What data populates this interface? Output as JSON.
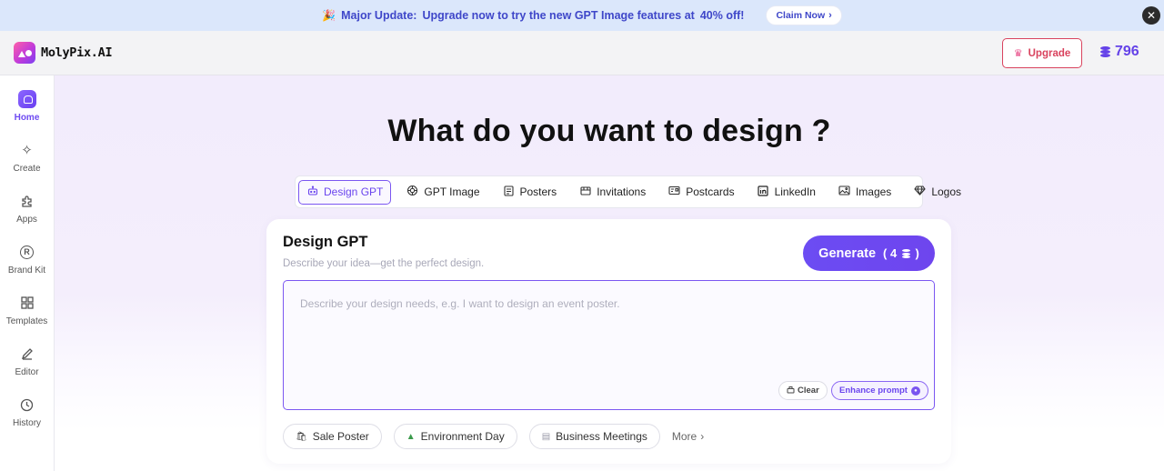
{
  "banner": {
    "party_icon": "party-popper-icon",
    "major": "Major Update:",
    "message": "Upgrade now to try the new GPT Image features at",
    "discount": "40% off!",
    "claim_label": "Claim Now",
    "close_icon": "close-icon"
  },
  "header": {
    "brand": "MolyPix.AI",
    "upgrade_label": "Upgrade",
    "credits": "796"
  },
  "sidebar": {
    "items": [
      {
        "label": "Home",
        "icon": "home-icon",
        "active": true
      },
      {
        "label": "Create",
        "icon": "sparkle-icon"
      },
      {
        "label": "Apps",
        "icon": "puzzle-icon"
      },
      {
        "label": "Brand Kit",
        "icon": "registered-icon"
      },
      {
        "label": "Templates",
        "icon": "grid-icon"
      },
      {
        "label": "Editor",
        "icon": "pencil-icon"
      },
      {
        "label": "History",
        "icon": "clock-icon"
      }
    ]
  },
  "main": {
    "title": "What do you want to design ?",
    "tabs": [
      {
        "label": "Design GPT",
        "icon": "robot-icon",
        "active": true
      },
      {
        "label": "GPT Image",
        "icon": "openai-icon"
      },
      {
        "label": "Posters",
        "icon": "poster-icon"
      },
      {
        "label": "Invitations",
        "icon": "invitation-icon"
      },
      {
        "label": "Postcards",
        "icon": "postcard-icon"
      },
      {
        "label": "LinkedIn",
        "icon": "linkedin-icon"
      },
      {
        "label": "Images",
        "icon": "image-icon"
      },
      {
        "label": "Logos",
        "icon": "diamond-icon"
      }
    ],
    "card": {
      "title": "Design GPT",
      "subtitle": "Describe your idea—get the perfect design.",
      "generate_label": "Generate",
      "generate_cost": "( 4",
      "generate_cost_end": ")",
      "prompt_placeholder": "Describe your design needs, e.g. I want to design an event poster.",
      "prompt_value": "",
      "clear_label": "Clear",
      "enhance_label": "Enhance prompt",
      "chips": [
        {
          "label": "Sale Poster",
          "icon": "shopping-icon"
        },
        {
          "label": "Environment Day",
          "icon": "tree-icon"
        },
        {
          "label": "Business Meetings",
          "icon": "document-icon"
        }
      ],
      "more_label": "More"
    }
  },
  "colors": {
    "accent": "#6c4cf3",
    "banner_bg": "#dbe7fb",
    "upgrade_red": "#d9435e"
  }
}
